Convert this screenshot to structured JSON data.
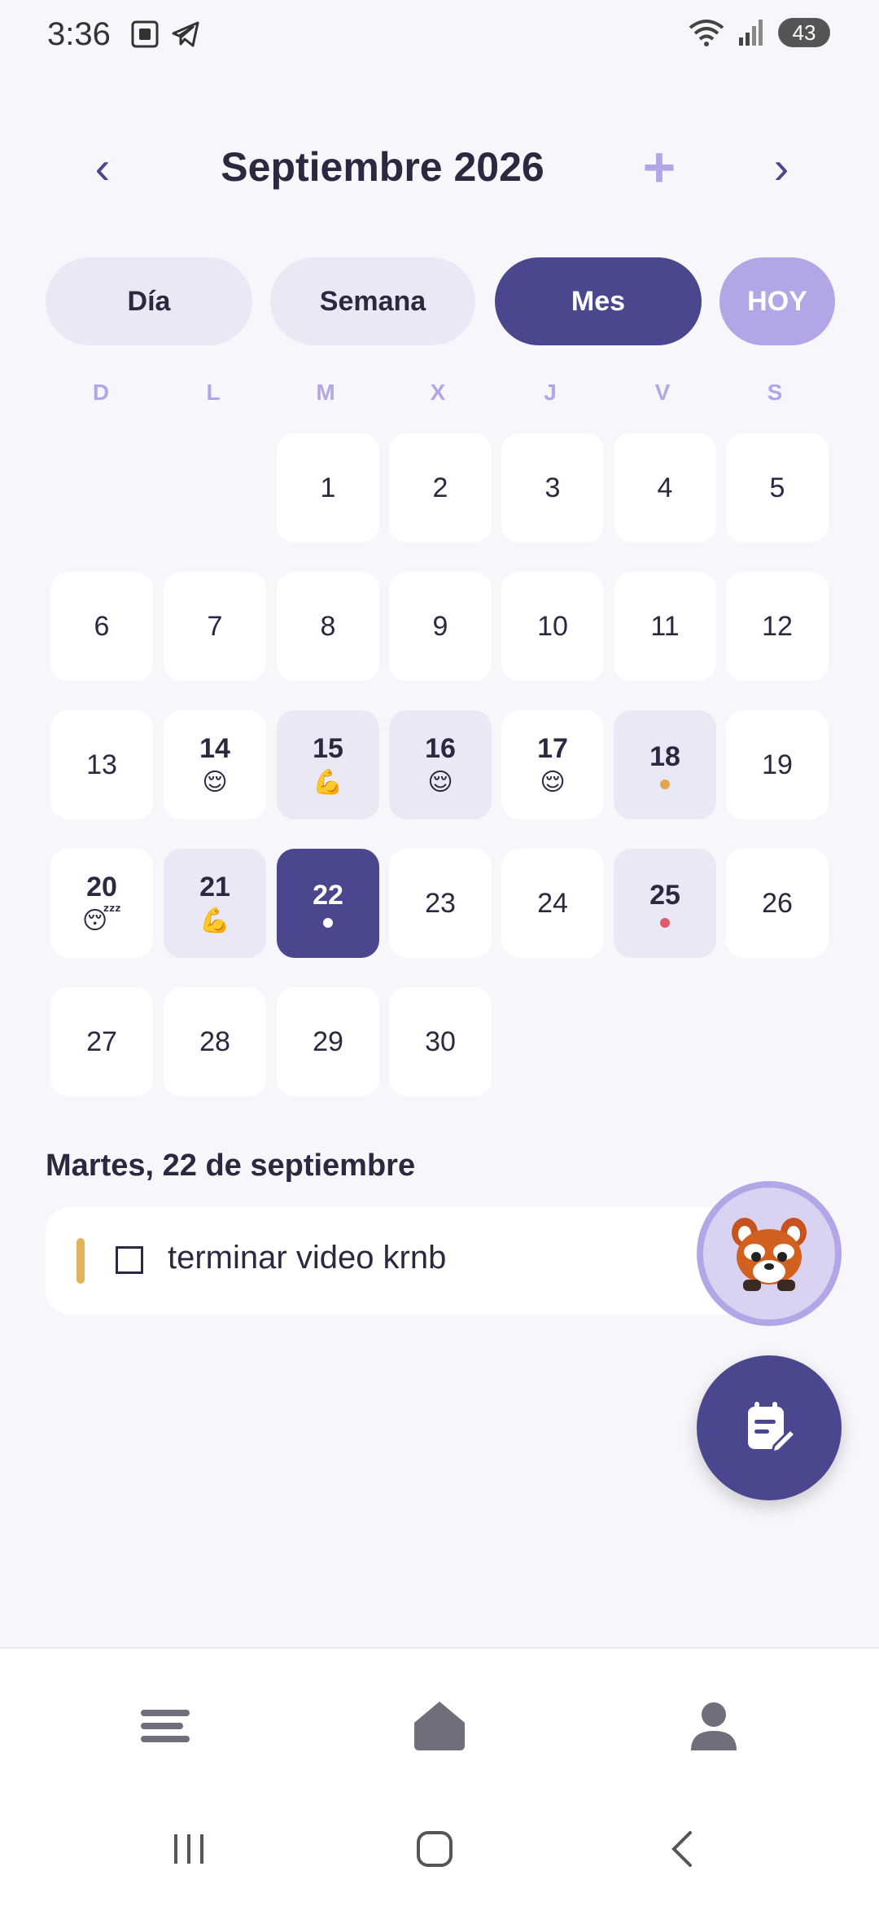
{
  "status_bar": {
    "time": "3:36",
    "battery": "43"
  },
  "header": {
    "month_title": "Septiembre 2026",
    "prev_symbol": "‹",
    "next_symbol": "›",
    "add_symbol": "+"
  },
  "view_tabs": {
    "day": "Día",
    "week": "Semana",
    "month": "Mes",
    "today": "HOY",
    "active": "Mes"
  },
  "weekdays": [
    "D",
    "L",
    "M",
    "X",
    "J",
    "V",
    "S"
  ],
  "calendar": {
    "days": [
      {
        "num": "1"
      },
      {
        "num": "2"
      },
      {
        "num": "3"
      },
      {
        "num": "4"
      },
      {
        "num": "5"
      },
      {
        "num": "6"
      },
      {
        "num": "7"
      },
      {
        "num": "8"
      },
      {
        "num": "9"
      },
      {
        "num": "10"
      },
      {
        "num": "11"
      },
      {
        "num": "12"
      },
      {
        "num": "13"
      },
      {
        "num": "14",
        "emoji": "😌",
        "bold": true
      },
      {
        "num": "15",
        "emoji": "💪",
        "bold": true,
        "active": true
      },
      {
        "num": "16",
        "emoji": "😌",
        "bold": true,
        "active": true
      },
      {
        "num": "17",
        "emoji": "😌",
        "bold": true
      },
      {
        "num": "18",
        "dot": "#e3a64e",
        "bold": true,
        "active": true
      },
      {
        "num": "19"
      },
      {
        "num": "20",
        "emoji": "😴",
        "bold": true
      },
      {
        "num": "21",
        "emoji": "💪",
        "bold": true,
        "active": true
      },
      {
        "num": "22",
        "dot": "#ffffff",
        "selected": true
      },
      {
        "num": "23"
      },
      {
        "num": "24"
      },
      {
        "num": "25",
        "dot": "#e25a6a",
        "bold": true,
        "active": true
      },
      {
        "num": "26"
      },
      {
        "num": "27"
      },
      {
        "num": "28"
      },
      {
        "num": "29"
      },
      {
        "num": "30"
      }
    ],
    "first_weekday_index": 2
  },
  "selected_day": {
    "label": "Martes, 22 de septiembre",
    "tasks": [
      {
        "text": "terminar video krnb",
        "color": "#e3b35a",
        "done": false
      }
    ]
  },
  "colors": {
    "primary": "#4b478e",
    "accent": "#b3a6e6",
    "soft": "#ebe8f6",
    "background": "#f7f6fb"
  },
  "icons": {
    "fab_avatar": "red-panda-avatar-icon",
    "fab_note": "note-edit-icon",
    "nav_menu": "menu-icon",
    "nav_home": "home-icon",
    "nav_profile": "profile-icon"
  }
}
